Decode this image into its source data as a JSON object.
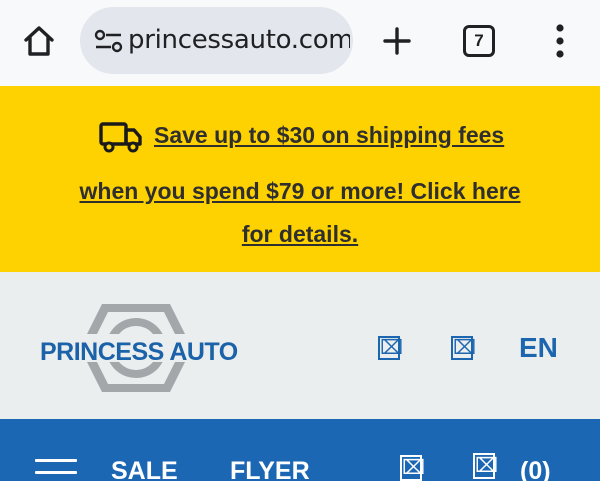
{
  "browser": {
    "url_display": "princessauto.com",
    "tab_count": "7",
    "icons": {
      "home": "home-icon",
      "site_info": "tune-icon",
      "new_tab": "plus-icon",
      "menu": "more-vert-icon"
    }
  },
  "promo": {
    "line1": "Save up to $30 on shipping fees",
    "line2": "when you spend $79 or more! Click here",
    "line3": "for details.",
    "icon": "truck-icon",
    "background": "#fed100"
  },
  "header": {
    "logo_text": "PRINCESS AUTO",
    "icon1_glyph": "⌧",
    "icon2_glyph": "⌧",
    "language": "EN",
    "accent_color": "#1c66b0"
  },
  "nav": {
    "items": [
      {
        "label": "SALE"
      },
      {
        "label": "FLYER"
      }
    ],
    "icon1_glyph": "⌧",
    "icon2_glyph": "⌧",
    "cart_count": "(0)",
    "background": "#1c67b4"
  }
}
